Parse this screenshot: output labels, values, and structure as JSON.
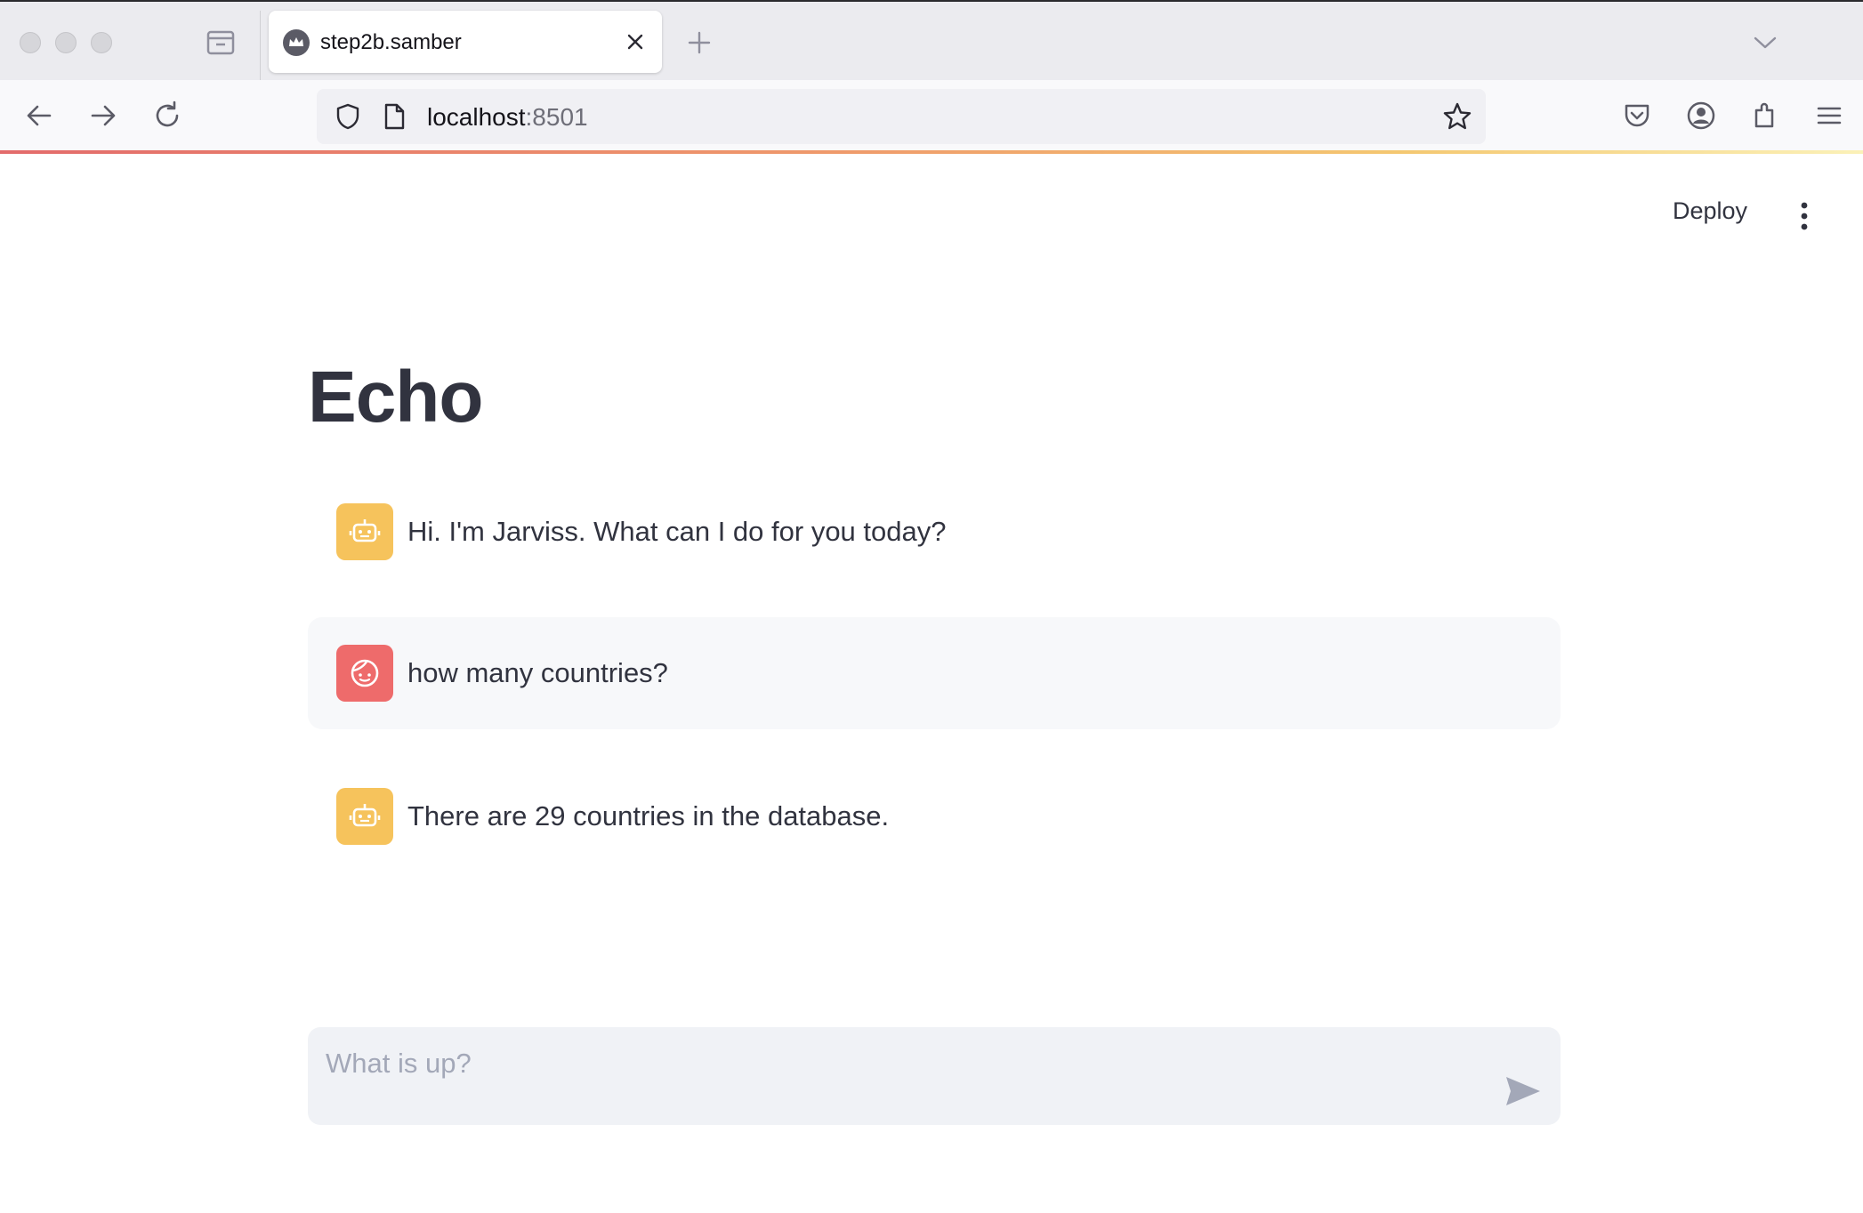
{
  "browser": {
    "tab": {
      "title": "step2b.samber"
    },
    "url": {
      "host": "localhost",
      "port": ":8501"
    }
  },
  "header": {
    "deploy_label": "Deploy"
  },
  "page": {
    "title": "Echo"
  },
  "messages": [
    {
      "role": "assistant",
      "avatar": "robot-icon",
      "text": "Hi. I'm Jarviss. What can I do for you today?"
    },
    {
      "role": "user",
      "avatar": "face-icon",
      "text": "how many countries?"
    },
    {
      "role": "assistant",
      "avatar": "robot-icon",
      "text": "There are 29 countries in the database."
    }
  ],
  "chat_input": {
    "placeholder": "What is up?",
    "value": ""
  },
  "colors": {
    "assistant_avatar": "#f6c35c",
    "user_avatar": "#ee6b6b",
    "text": "#31333f",
    "user_message_bg": "#f7f8fa",
    "input_bg": "#f0f2f6"
  }
}
